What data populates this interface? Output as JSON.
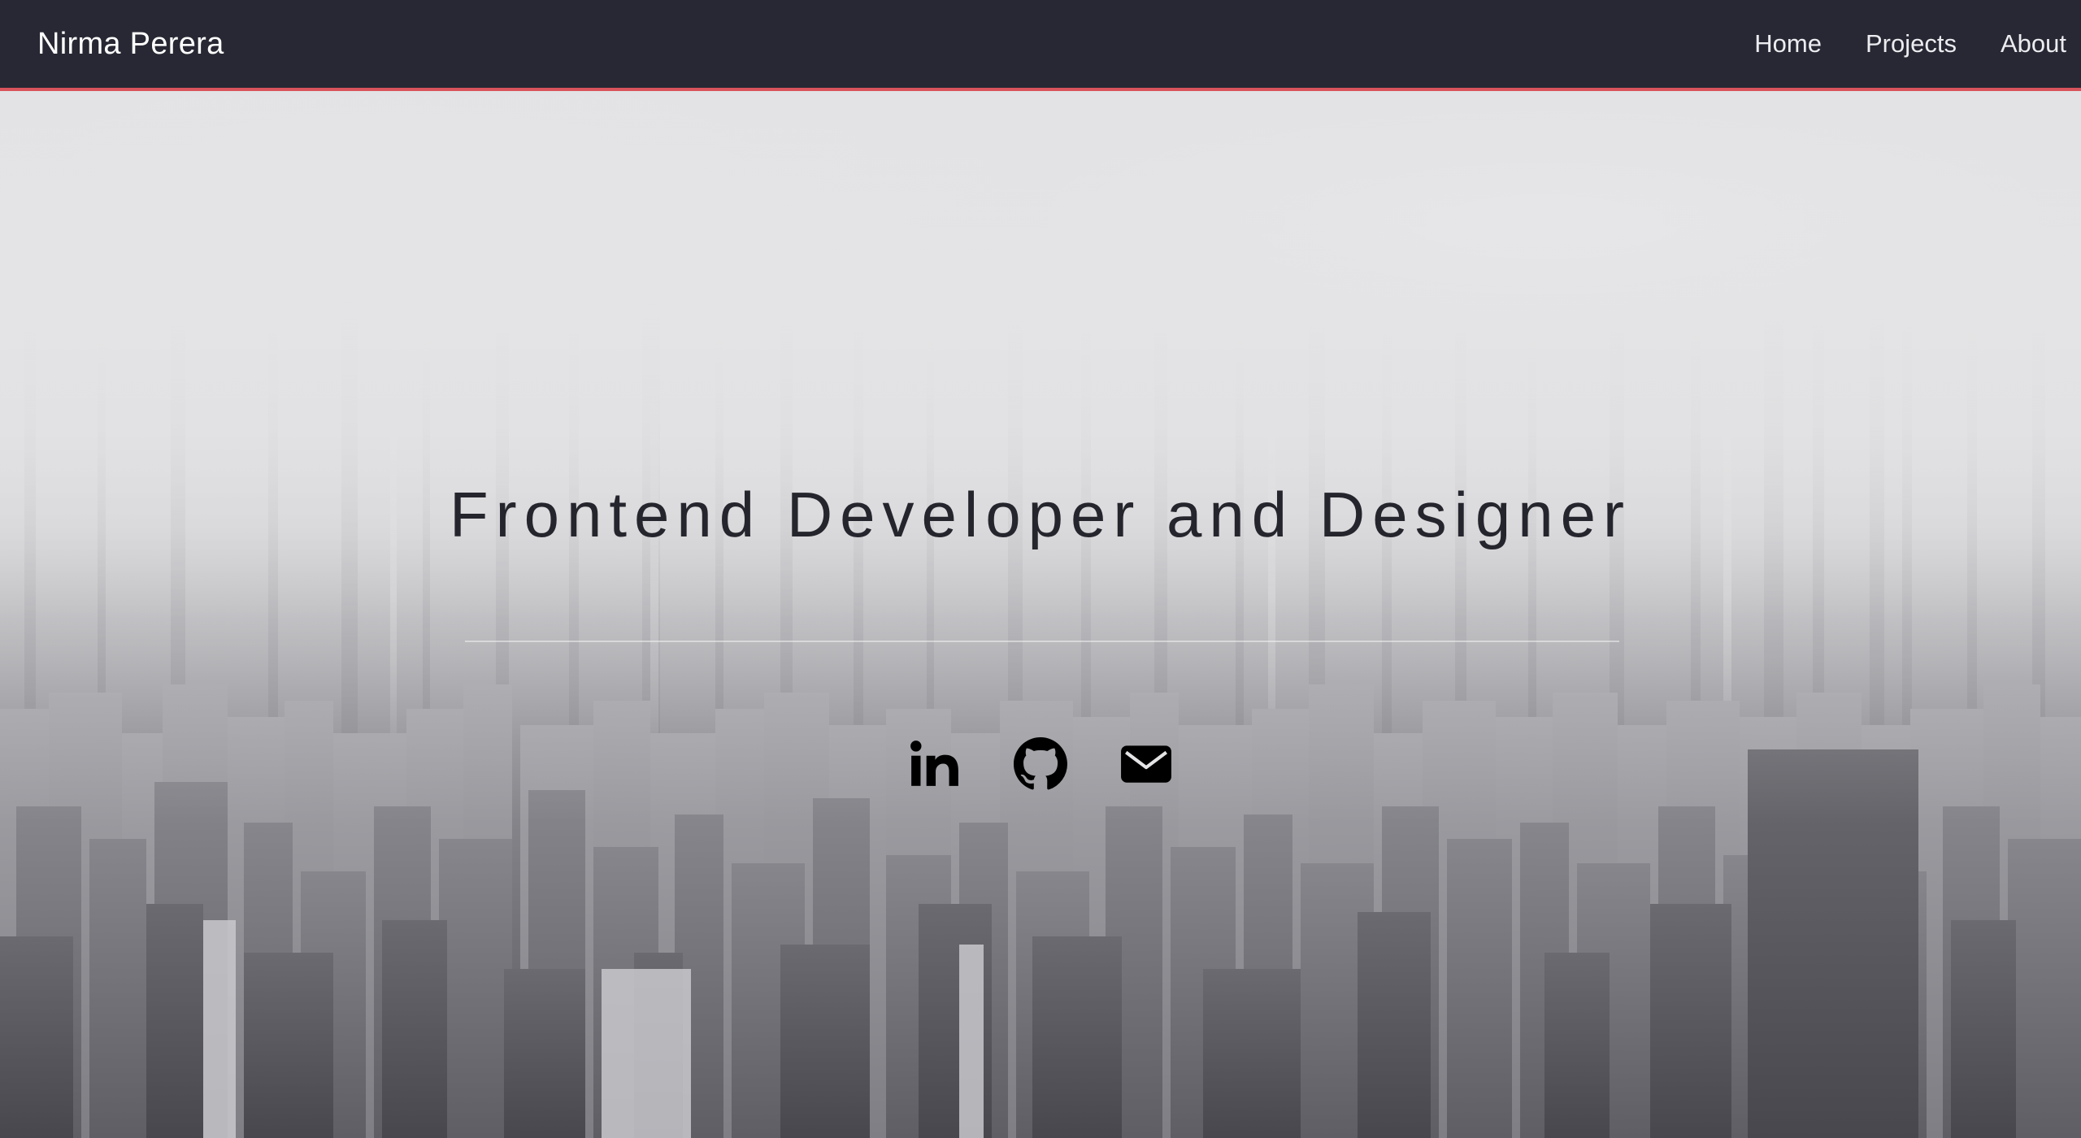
{
  "navbar": {
    "brand": "Nirma Perera",
    "links": [
      "Home",
      "Projects",
      "About"
    ]
  },
  "hero": {
    "headline": "Frontend Developer and Designer",
    "social": [
      {
        "icon": "linkedin-icon"
      },
      {
        "icon": "github-icon"
      },
      {
        "icon": "envelope-icon"
      }
    ]
  },
  "colors": {
    "navbar_bg": "#272833",
    "navbar_accent": "#d9535b",
    "headline": "#25252d",
    "icons": "#000000"
  }
}
